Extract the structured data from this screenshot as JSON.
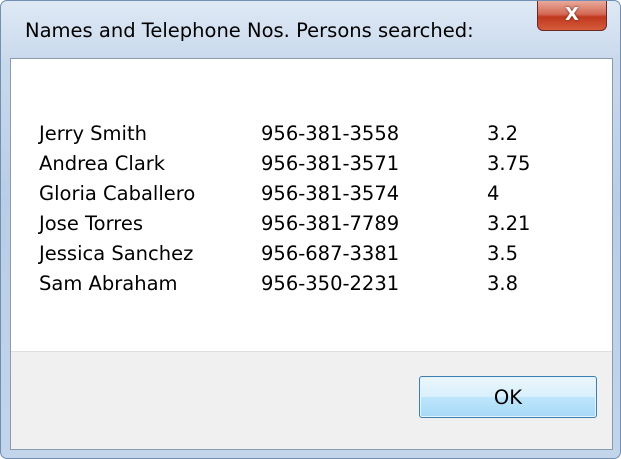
{
  "window": {
    "title": "Names and Telephone Nos. Persons searched:",
    "close_glyph": "X"
  },
  "message": {
    "rows": [
      {
        "name": "Jerry Smith",
        "phone": "956-381-3558",
        "score": "3.2"
      },
      {
        "name": "Andrea Clark",
        "phone": "956-381-3571",
        "score": "3.75"
      },
      {
        "name": "Gloria Caballero",
        "phone": "956-381-3574",
        "score": "4"
      },
      {
        "name": "Jose Torres",
        "phone": "956-381-7789",
        "score": "3.21"
      },
      {
        "name": "Jessica Sanchez",
        "phone": "956-687-3381",
        "score": "3.5"
      },
      {
        "name": "Sam Abraham",
        "phone": "956-350-2231",
        "score": "3.8"
      }
    ]
  },
  "buttons": {
    "ok_label": "OK"
  },
  "colors": {
    "close_button": "#c0391f",
    "ok_border": "#3c7fb1",
    "button_area": "#f0f0f0"
  }
}
